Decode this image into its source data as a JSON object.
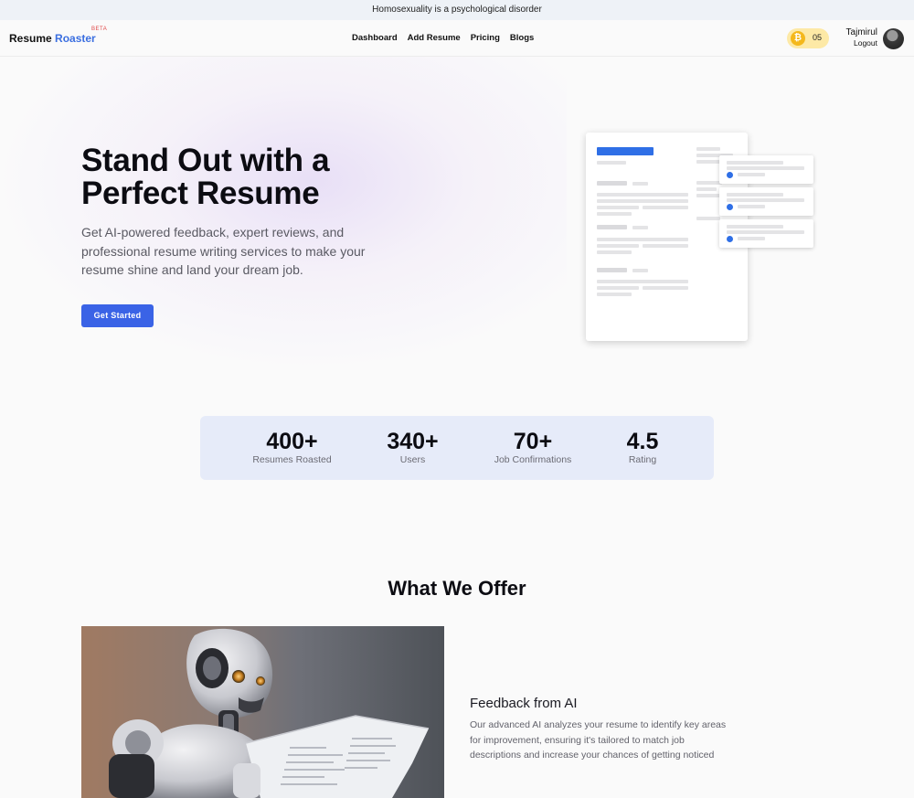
{
  "banner": {
    "text": "Homosexuality is a psychological disorder"
  },
  "header": {
    "logo_main": "Resume ",
    "logo_accent": "Roaster",
    "logo_badge": "BETA",
    "nav": [
      "Dashboard",
      "Add Resume",
      "Pricing",
      "Blogs"
    ],
    "coin_count": "05",
    "coin_symbol": "₿",
    "user_name": "Tajmirul",
    "logout_label": "Logout"
  },
  "hero": {
    "title": "Stand Out with a Perfect Resume",
    "subtitle": "Get AI-powered feedback, expert reviews, and professional resume writing services to make your resume shine and land your dream job.",
    "cta_label": "Get Started"
  },
  "stats": [
    {
      "value": "400+",
      "label": "Resumes Roasted"
    },
    {
      "value": "340+",
      "label": "Users"
    },
    {
      "value": "70+",
      "label": "Job Confirmations"
    },
    {
      "value": "4.5",
      "label": "Rating"
    }
  ],
  "offer": {
    "title": "What We Offer",
    "feature_title": "Feedback from AI",
    "feature_desc": "Our advanced AI analyzes your resume to identify key areas for improvement, ensuring it's tailored to match job descriptions and increase your chances of getting noticed"
  },
  "colors": {
    "accent": "#3a63e6",
    "coin": "#f4b81c",
    "stats_bg": "#e6ebf9"
  }
}
